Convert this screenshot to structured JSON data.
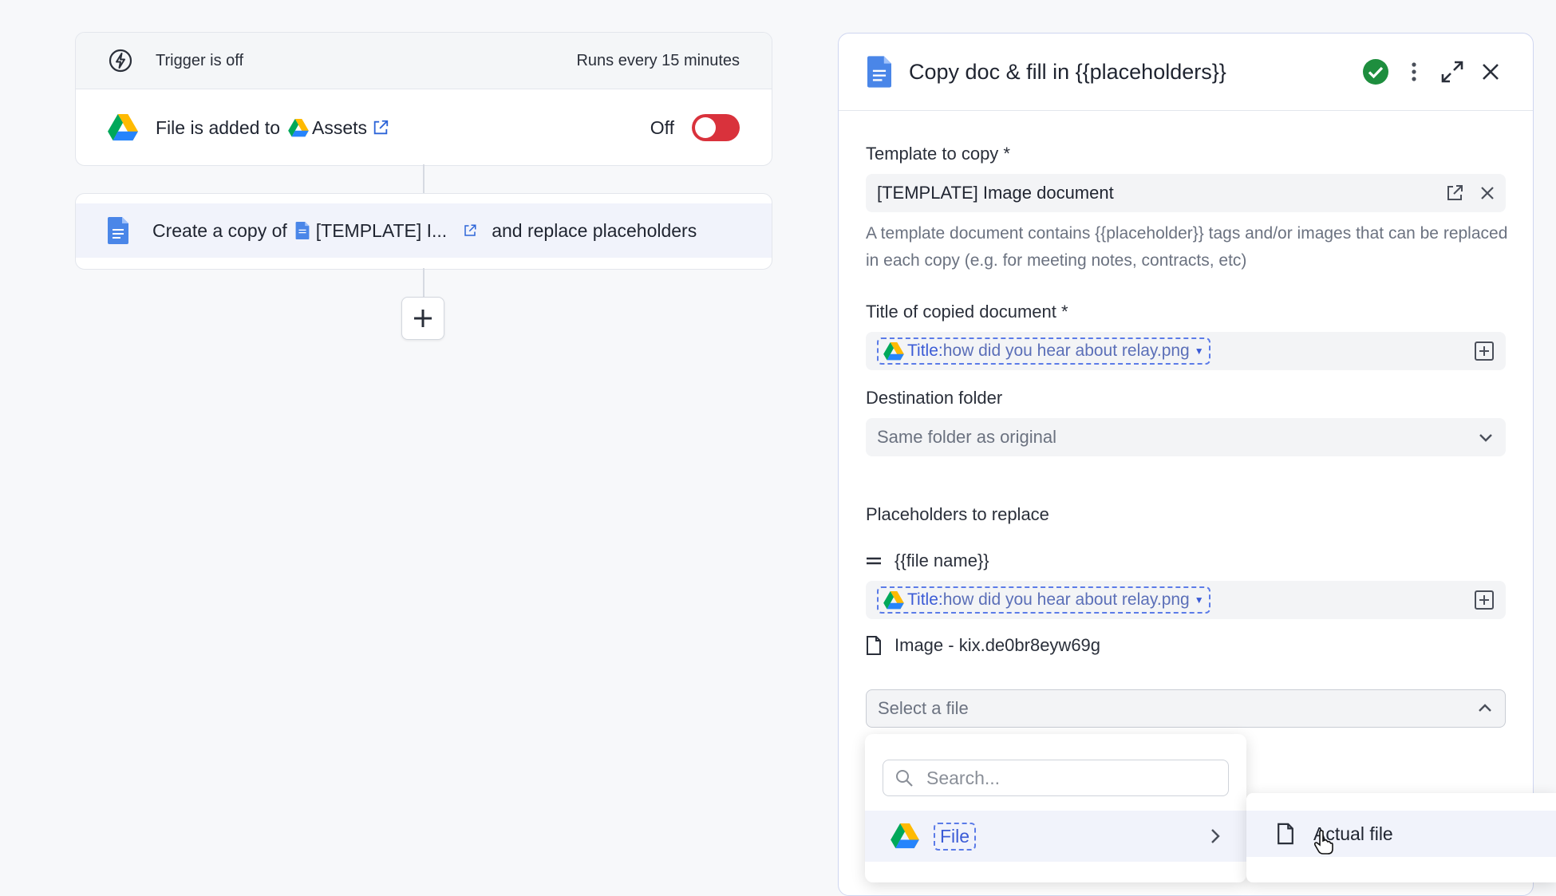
{
  "trigger": {
    "status_text": "Trigger is off",
    "schedule_text": "Runs every 15 minutes",
    "event_prefix": "File is added to",
    "folder_name": "Assets",
    "toggle_label": "Off",
    "toggle_state": "off"
  },
  "action": {
    "prefix": "Create a copy of",
    "template_short": "[TEMPLATE] I...",
    "suffix": "and replace placeholders"
  },
  "panel": {
    "title": "Copy doc & fill in {{placeholders}}",
    "template_label": "Template to copy *",
    "template_value": "[TEMPLATE] Image document",
    "template_help": "A template document contains {{placeholder}} tags and/or images that can be replaced in each copy (e.g. for meeting notes, contracts, etc)",
    "title_label": "Title of copied document *",
    "title_pill_key": "Title:",
    "title_pill_value": "how did you hear about relay.png",
    "destination_label": "Destination folder",
    "destination_value": "Same folder as original",
    "placeholders_label": "Placeholders to replace",
    "placeholder_1_name": "{{file name}}",
    "placeholder_1_pill_key": "Title:",
    "placeholder_1_pill_value": "how did you hear about relay.png",
    "placeholder_2_name": "Image - kix.de0br8eyw69g",
    "placeholder_2_placeholder": "Select a file"
  },
  "dropdown": {
    "search_placeholder": "Search...",
    "item_label": "File",
    "submenu_item": "Actual file"
  },
  "colors": {
    "accent": "#3b5bd6",
    "toggle_off": "#d9323c",
    "success": "#1e8e3e",
    "doc_blue": "#4a86e8"
  },
  "icons": [
    "bolt-icon",
    "google-drive-icon",
    "external-link-icon",
    "google-docs-icon",
    "plus-icon",
    "check-circle-icon",
    "more-vertical-icon",
    "expand-icon",
    "close-icon",
    "add-variable-icon",
    "chevron-down-icon",
    "chevron-up-icon",
    "equals-icon",
    "file-icon",
    "search-icon",
    "chevron-right-icon",
    "pointer-cursor-icon"
  ]
}
